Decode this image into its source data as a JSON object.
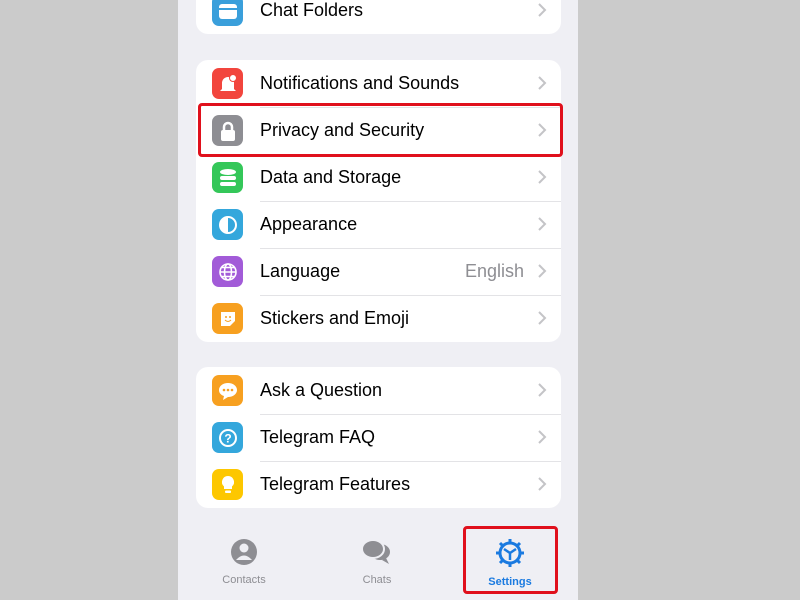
{
  "groups": [
    [
      {
        "label": "Chat Folders",
        "icon": "folder-icon",
        "color": "#3a9fdb"
      }
    ],
    [
      {
        "label": "Notifications and Sounds",
        "icon": "bell-icon",
        "color": "#f2453d"
      },
      {
        "label": "Privacy and Security",
        "icon": "lock-icon",
        "color": "#8e8e93",
        "highlighted": true
      },
      {
        "label": "Data and Storage",
        "icon": "database-icon",
        "color": "#34c759"
      },
      {
        "label": "Appearance",
        "icon": "half-circle-icon",
        "color": "#34a7dc"
      },
      {
        "label": "Language",
        "icon": "globe-icon",
        "color": "#a25bd8",
        "value": "English"
      },
      {
        "label": "Stickers and Emoji",
        "icon": "sticker-icon",
        "color": "#f7a020"
      }
    ],
    [
      {
        "label": "Ask a Question",
        "icon": "chat-bubble-icon",
        "color": "#f7a020"
      },
      {
        "label": "Telegram FAQ",
        "icon": "question-icon",
        "color": "#34a7dc"
      },
      {
        "label": "Telegram Features",
        "icon": "lightbulb-icon",
        "color": "#fdc700"
      }
    ]
  ],
  "tabbar": {
    "tabs": [
      {
        "label": "Contacts",
        "icon": "person-icon"
      },
      {
        "label": "Chats",
        "icon": "chats-icon"
      },
      {
        "label": "Settings",
        "icon": "gear-icon",
        "active": true
      }
    ]
  },
  "colors": {
    "accent": "#1a7ae0",
    "highlight": "#e0101c",
    "inactive": "#8e8e93"
  }
}
